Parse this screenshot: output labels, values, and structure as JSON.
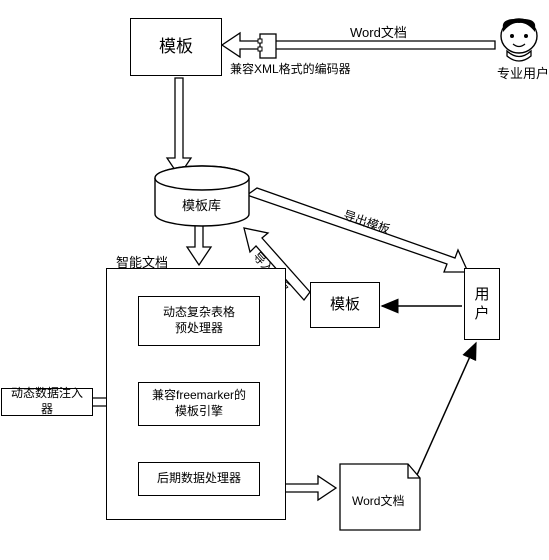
{
  "nodes": {
    "template_top": "模板",
    "encoder_label": "兼容XML格式的编码器",
    "word_doc_label_top": "Word文档",
    "pro_user_label": "专业用户",
    "template_repo": "模板库",
    "smart_doc_title": "智能文档",
    "preprocessor": "动态复杂表格\n预处理器",
    "engine": "兼容freemarker的\n模板引擎",
    "postprocessor": "后期数据处理器",
    "data_injector": "动态数据注入器",
    "template_mid": "模板",
    "user": "用\n户",
    "word_doc_bottom": "Word文档",
    "import_template_label": "导入模板",
    "export_template_label": "导出模板"
  },
  "chart_data": {
    "type": "diagram",
    "title": "",
    "nodes": [
      {
        "id": "pro_user",
        "label": "专业用户",
        "kind": "actor"
      },
      {
        "id": "word_in",
        "label": "Word文档",
        "kind": "data"
      },
      {
        "id": "encoder",
        "label": "兼容XML格式的编码器",
        "kind": "process"
      },
      {
        "id": "template_top",
        "label": "模板",
        "kind": "data"
      },
      {
        "id": "template_repo",
        "label": "模板库",
        "kind": "datastore"
      },
      {
        "id": "smart_doc",
        "label": "智能文档",
        "kind": "container"
      },
      {
        "id": "preprocessor",
        "label": "动态复杂表格预处理器",
        "kind": "process",
        "parent": "smart_doc"
      },
      {
        "id": "engine",
        "label": "兼容freemarker的模板引擎",
        "kind": "process",
        "parent": "smart_doc"
      },
      {
        "id": "postprocessor",
        "label": "后期数据处理器",
        "kind": "process",
        "parent": "smart_doc"
      },
      {
        "id": "data_injector",
        "label": "动态数据注入器",
        "kind": "process"
      },
      {
        "id": "template_mid",
        "label": "模板",
        "kind": "data"
      },
      {
        "id": "user",
        "label": "用户",
        "kind": "actor"
      },
      {
        "id": "word_out",
        "label": "Word文档",
        "kind": "data"
      }
    ],
    "edges": [
      {
        "from": "pro_user",
        "to": "template_top",
        "via": "encoder",
        "label": "Word文档"
      },
      {
        "from": "template_top",
        "to": "template_repo"
      },
      {
        "from": "template_repo",
        "to": "smart_doc"
      },
      {
        "from": "preprocessor",
        "to": "engine"
      },
      {
        "from": "engine",
        "to": "postprocessor"
      },
      {
        "from": "data_injector",
        "to": "engine"
      },
      {
        "from": "postprocessor",
        "to": "word_out"
      },
      {
        "from": "word_out",
        "to": "user"
      },
      {
        "from": "user",
        "to": "template_mid"
      },
      {
        "from": "template_mid",
        "to": "template_repo",
        "label": "导入模板"
      },
      {
        "from": "template_repo",
        "to": "user",
        "label": "导出模板"
      }
    ]
  }
}
